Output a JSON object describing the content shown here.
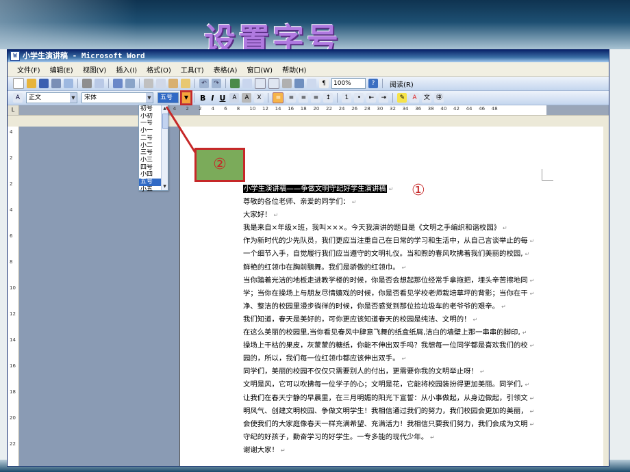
{
  "slide": {
    "title": "设置字号"
  },
  "window": {
    "title": "小学生演讲稿 - Microsoft Word"
  },
  "menu": {
    "items": [
      "文件(F)",
      "编辑(E)",
      "视图(V)",
      "插入(I)",
      "格式(O)",
      "工具(T)",
      "表格(A)",
      "窗口(W)",
      "帮助(H)"
    ]
  },
  "toolbar": {
    "zoom": "100%",
    "read_label": "阅读(R)"
  },
  "format_toolbar": {
    "style": "正文",
    "font": "宋体",
    "size": "五号",
    "bold": "B",
    "italic": "I",
    "underline": "U"
  },
  "size_list": {
    "options": [
      "初号",
      "小初",
      "一号",
      "小一",
      "二号",
      "小二",
      "三号",
      "小三",
      "四号",
      "小四",
      "五号",
      "小五"
    ],
    "selected": "五号"
  },
  "ruler": {
    "h_ticks": [
      "8",
      "6",
      "4",
      "2",
      "2",
      "4",
      "6",
      "8",
      "10",
      "12",
      "14",
      "16",
      "18",
      "20",
      "22",
      "24",
      "26",
      "28",
      "30",
      "32",
      "34",
      "36",
      "38",
      "40",
      "42",
      "44",
      "46",
      "48"
    ],
    "v_ticks": [
      "4",
      "2",
      "2",
      "4",
      "6",
      "8",
      "10",
      "12",
      "14",
      "16",
      "18",
      "20",
      "22"
    ]
  },
  "callouts": {
    "one": "①",
    "two": "②"
  },
  "document": {
    "title": "小学生演讲稿——争做文明守纪好学生演讲稿",
    "lines": [
      "尊敬的各位老师、亲爱的同学们：",
      "大家好！",
      "我是来自×年级×班，我叫×××。今天我演讲的题目是《文明之手编织和谐校园》",
      "作为新时代的少先队员，我们更应当注重自己在日常的学习和生活中，从自己言谈举止的每",
      "一个细节入手，自觉履行我们应当遵守的文明礼仪。当和煦的春风吹拂着我们美丽的校园,",
      "鲜艳的红领巾在胸前飘舞。我们是骄傲的红领巾。",
      "当你踏着光洁的地板走进教学楼的时候，你是否会想起那位经常手拿拖把，埋头辛苦擦地同",
      "学；当你在操场上与朋友尽情嬉戏的时候，你是否看见学校老师栽培草坪的背影；当你在干",
      "净、整洁的校园里漫步徜徉的时候，你是否感觉到那位捡垃圾车的老爷爷的艰辛。",
      "我们知道，春天是美好的，可你更应该知道春天的校园是纯洁、文明的！",
      "在这么美丽的校园里,当你看见春风中肆意飞舞的纸盒纸屑,洁白的墙壁上那一串串的脚印,",
      "操场上干枯的果皮，灰蒙蒙的糖纸，你能不伸出双手吗？我想每一位同学都是喜欢我们的校",
      "园的，所以，我们每一位红领巾都应该伸出双手。",
      "同学们，美丽的校园不仅仅只需要别人的付出，更需要你我的文明举止呀！",
      "文明是风，它可以吹拂每一位学子的心；文明是花，它能将校园装扮得更加美丽。同学们,",
      "让我们在春天宁静的早晨里，在三月明媚的阳光下宣誓：从小事做起，从身边做起，引领文",
      "明风气、创建文明校园、争做文明学生！我相信通过我们的努力，我们校园会更加的美丽，",
      "会使我们的大家庭像春天一样充满希望、充满活力！我相信只要我们努力，我们会成为文明",
      "守纪的好孩子，勤奋学习的好学生。一专多能的现代少年。",
      "谢谢大家！"
    ]
  }
}
